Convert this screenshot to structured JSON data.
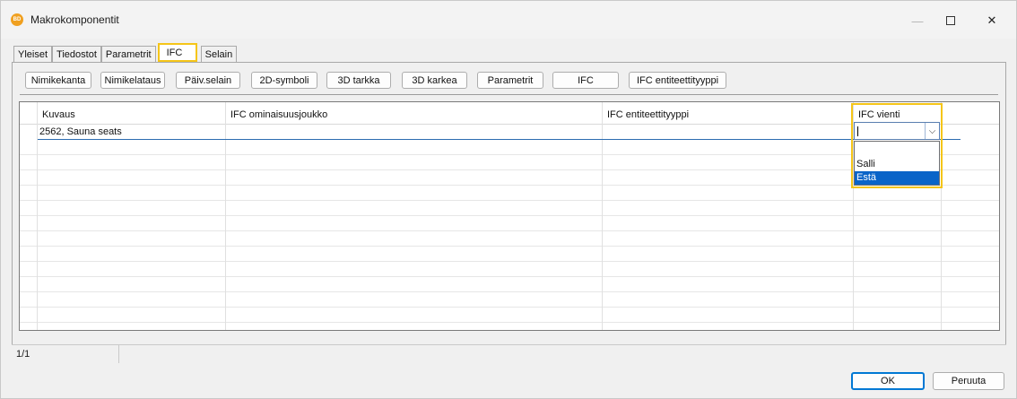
{
  "window": {
    "title": "Makrokomponentit",
    "app_icon_text": "BD"
  },
  "tabs": [
    "Yleiset",
    "Tiedostot",
    "Parametrit",
    "IFC",
    "Selain"
  ],
  "active_tab": "IFC",
  "toolbar": {
    "buttons": [
      "Nimikekanta",
      "Nimikelataus",
      "Päiv.selain",
      "2D-symboli",
      "3D tarkka",
      "3D karkea",
      "Parametrit",
      "IFC",
      "IFC entiteettityyppi"
    ]
  },
  "grid": {
    "columns": [
      "Kuvaus",
      "IFC ominaisuusjoukko",
      "IFC entiteettityyppi",
      "IFC vienti"
    ],
    "rows": [
      {
        "kuvaus": "2562, Sauna seats",
        "ifc_ominaisuusjoukko": "",
        "ifc_entiteettityyppi": "",
        "ifc_vienti": ""
      }
    ]
  },
  "dropdown": {
    "options": [
      "",
      "Salli",
      "Estä"
    ],
    "highlighted": "Estä"
  },
  "status": {
    "count": "1/1"
  },
  "buttons": {
    "ok": "OK",
    "cancel": "Peruuta"
  },
  "colors": {
    "highlight": "#f5c518",
    "selection": "#0a64c8"
  }
}
